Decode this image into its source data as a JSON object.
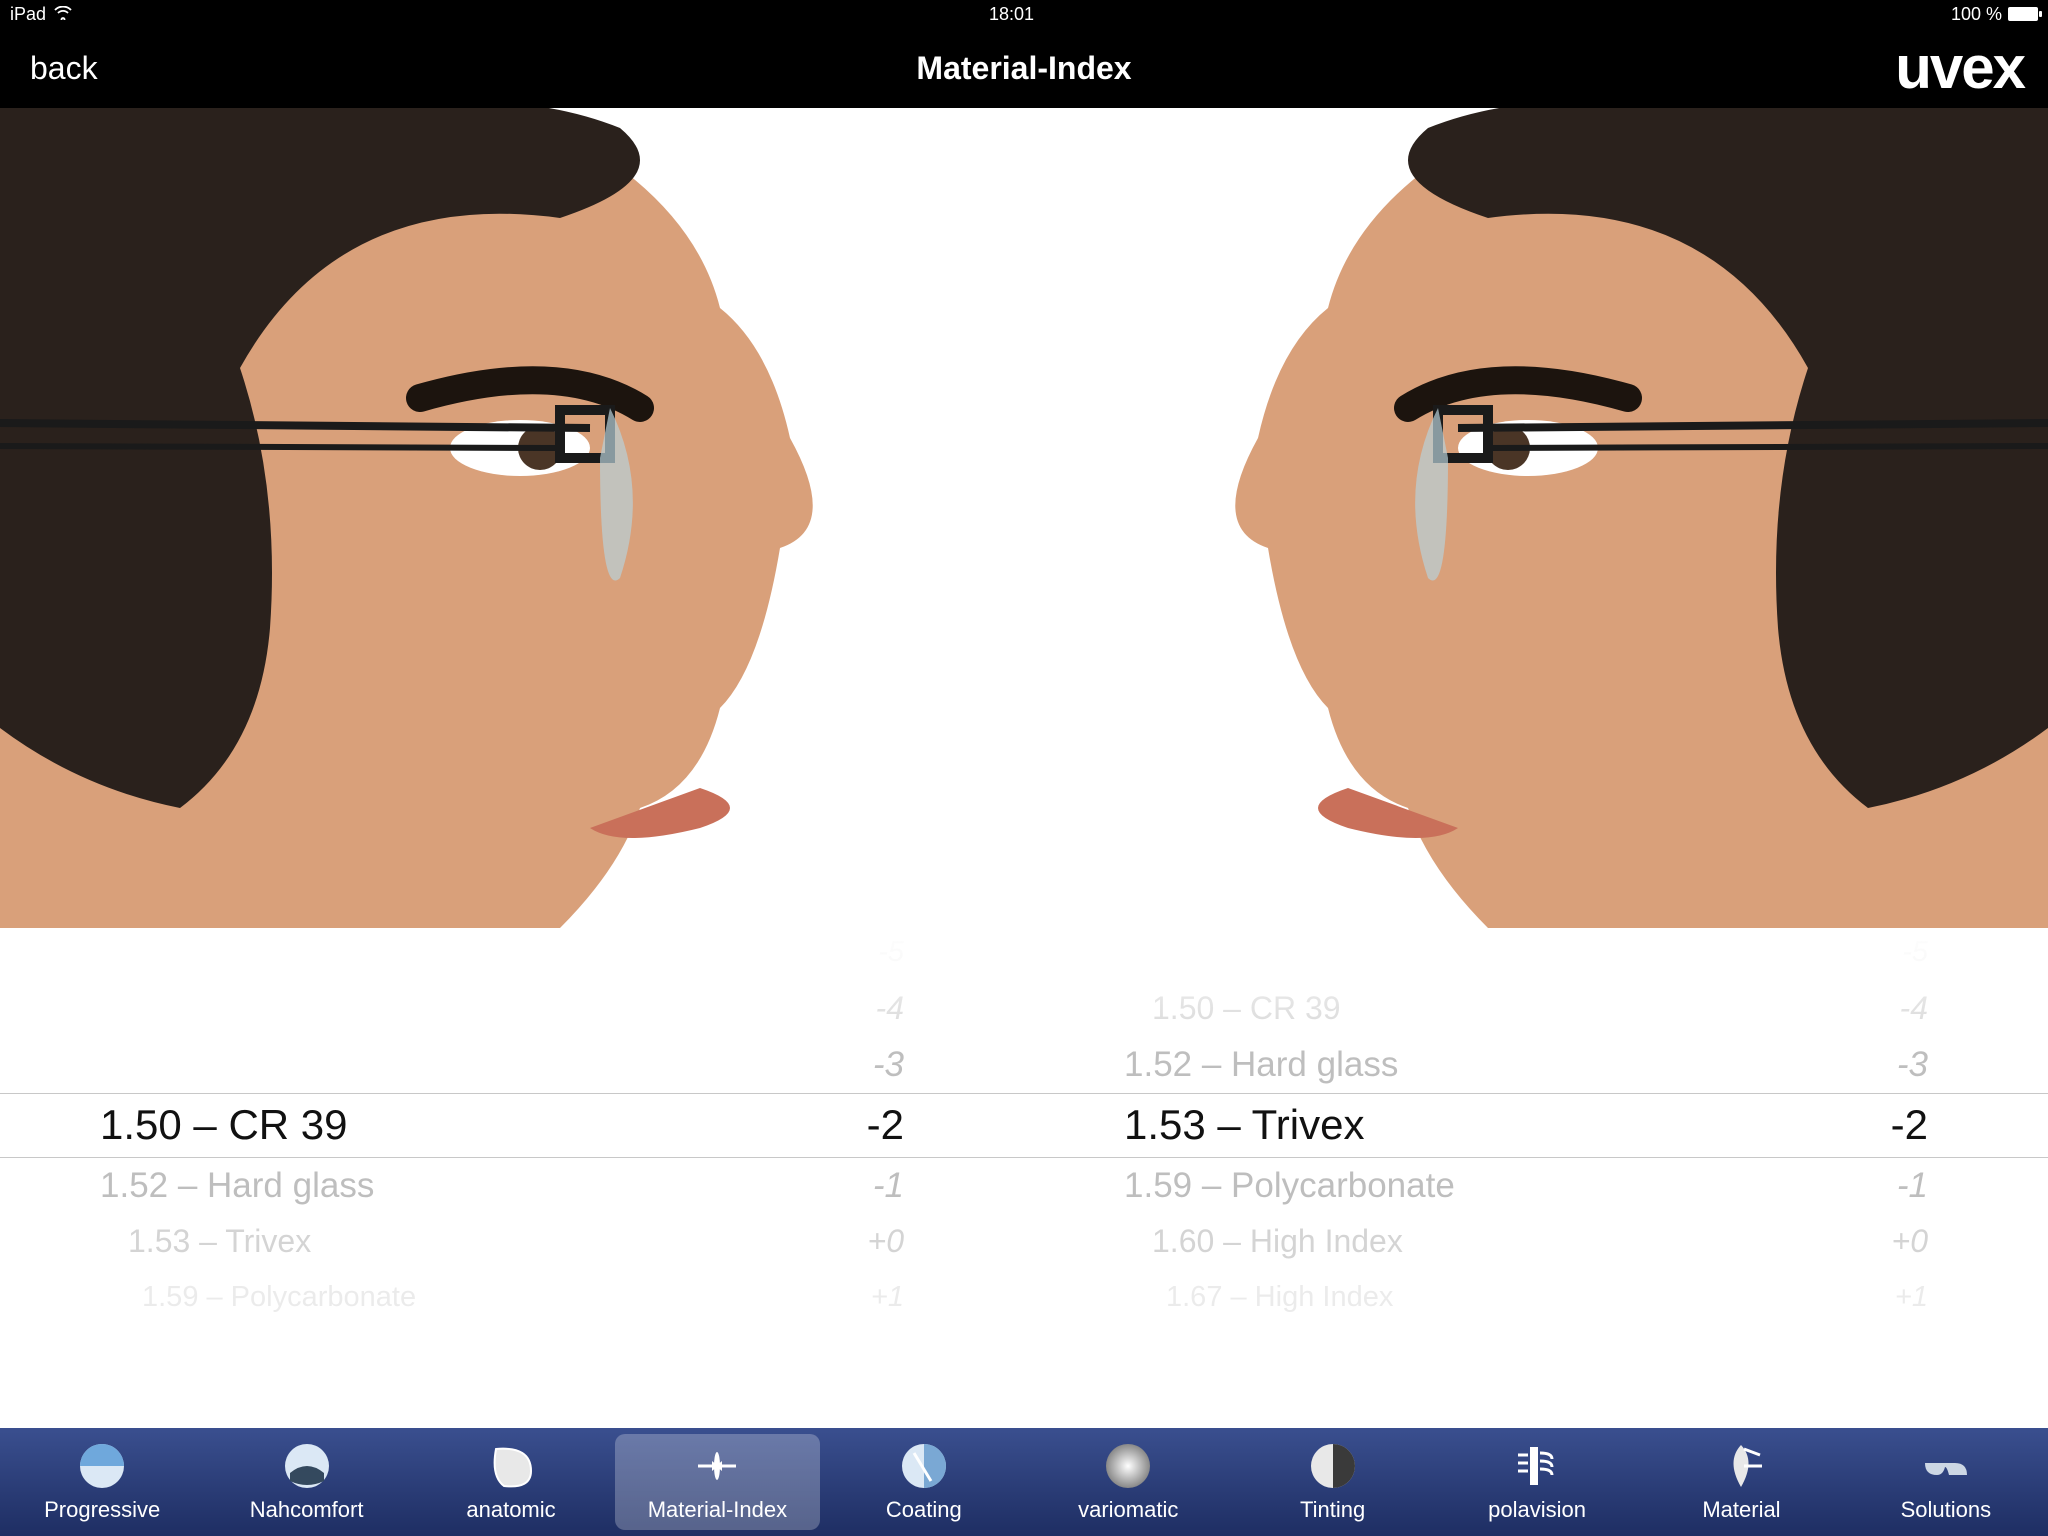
{
  "status": {
    "device": "iPad",
    "time": "18:01",
    "battery_pct": "100 %"
  },
  "nav": {
    "back": "back",
    "title": "Material-Index",
    "brand": "uvex"
  },
  "pickers": {
    "left": {
      "materials": [
        "1.50 – CR 39",
        "1.52 – Hard glass",
        "1.53 – Trivex",
        "1.59 – Polycarbonate"
      ],
      "materials_selected_index": 0,
      "diopters": [
        "-5",
        "-4",
        "-3",
        "-2",
        "-1",
        "+0",
        "+1"
      ],
      "diopters_selected_index": 3
    },
    "right": {
      "materials": [
        "1.50 – CR 39",
        "1.52 – Hard glass",
        "1.53 – Trivex",
        "1.59 – Polycarbonate",
        "1.60 – High Index",
        "1.67 – High Index"
      ],
      "materials_selected_index": 2,
      "diopters": [
        "-5",
        "-4",
        "-3",
        "-2",
        "-1",
        "+0",
        "+1"
      ],
      "diopters_selected_index": 3
    }
  },
  "tabs": [
    {
      "label": "Progressive",
      "icon": "lens-progressive"
    },
    {
      "label": "Nahcomfort",
      "icon": "lens-near"
    },
    {
      "label": "anatomic",
      "icon": "lens-anatomic"
    },
    {
      "label": "Material-Index",
      "icon": "lens-material",
      "active": true
    },
    {
      "label": "Coating",
      "icon": "lens-coating"
    },
    {
      "label": "variomatic",
      "icon": "lens-vario"
    },
    {
      "label": "Tinting",
      "icon": "lens-tint"
    },
    {
      "label": "polavision",
      "icon": "lens-pola"
    },
    {
      "label": "Material",
      "icon": "lens-material2"
    },
    {
      "label": "Solutions",
      "icon": "glasses"
    }
  ]
}
